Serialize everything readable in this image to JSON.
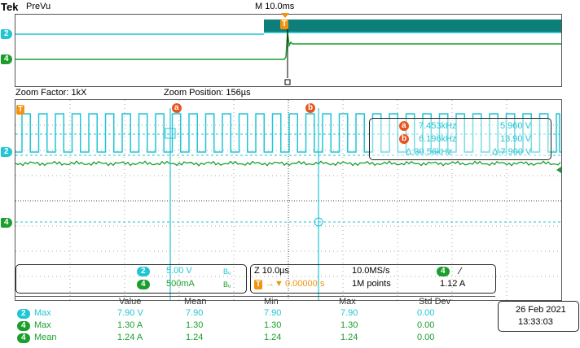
{
  "colors": {
    "ch2": "#22c5d4",
    "ch4": "#1b9e2e",
    "trigger": "#f29410",
    "marker": "#e8541e",
    "preview_fill": "#0c7f7a"
  },
  "header": {
    "brand": "Tek",
    "mode": "PreVu",
    "timebase": "M 10.0ms"
  },
  "zoom": {
    "factor_label": "Zoom Factor: 1kX",
    "position_label": "Zoom Position: 156µs"
  },
  "markers": {
    "a": "a",
    "b": "b",
    "trigger": "T"
  },
  "channel_badges": {
    "ch2": "2",
    "ch4": "4"
  },
  "cursor_readout": {
    "a_label": "a",
    "a_freq": "7.453kHz",
    "a_volt": "5.960 V",
    "b_label": "b",
    "b_freq": "6.196kHz",
    "b_volt": "13.90 V",
    "delta_freq": "Δ:30.56kHz",
    "delta_volt": "Δ:7.900 V"
  },
  "channel_settings": [
    {
      "ch": "2",
      "scale": "5.00 V",
      "suffix": "Bᵤ"
    },
    {
      "ch": "4",
      "scale": "500mA",
      "suffix": "Bᵤ"
    }
  ],
  "acquisition": {
    "zoom_scale": "Z 10.0µs",
    "trig_pos": "0.00000 s",
    "sample_rate": "10.0MS/s",
    "record_length": "1M points",
    "trig_ch": "4",
    "trig_slope": "∕",
    "trig_level": "1.12 A"
  },
  "measurements": {
    "headers": [
      "Value",
      "Mean",
      "Min",
      "Max",
      "Std Dev"
    ],
    "rows": [
      {
        "ch": "2",
        "name": "Max",
        "value": "7.90 V",
        "mean": "7.90",
        "min": "7.90",
        "max": "7.90",
        "std": "0.00"
      },
      {
        "ch": "4",
        "name": "Max",
        "value": "1.30 A",
        "mean": "1.30",
        "min": "1.30",
        "max": "1.30",
        "std": "0.00"
      },
      {
        "ch": "4",
        "name": "Mean",
        "value": "1.24 A",
        "mean": "1.24",
        "min": "1.24",
        "max": "1.24",
        "std": "0.00"
      }
    ]
  },
  "datetime": {
    "date": "26 Feb  2021",
    "time": "13:33:03"
  }
}
